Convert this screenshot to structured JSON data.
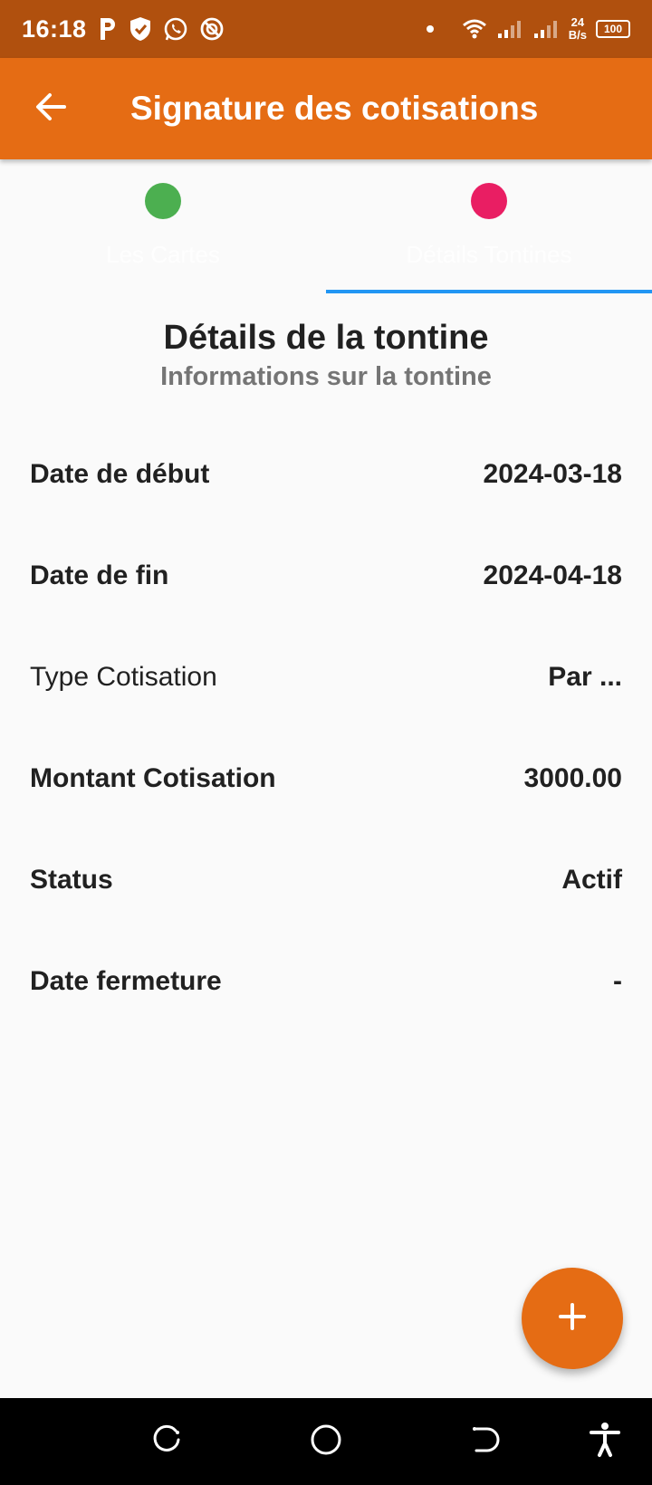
{
  "status_bar": {
    "time": "16:18",
    "net_speed_value": "24",
    "net_speed_unit": "B/s",
    "battery": "100"
  },
  "app_bar": {
    "title": "Signature des cotisations"
  },
  "tabs": [
    {
      "label": "Les Cartes",
      "dot_color": "#4caf50",
      "selected": false
    },
    {
      "label": "Détails Tontines",
      "dot_color": "#e91e63",
      "selected": true
    }
  ],
  "section": {
    "title": "Détails de la tontine",
    "subtitle": "Informations sur la tontine"
  },
  "details": [
    {
      "label": "Date de début",
      "value": "2024-03-18"
    },
    {
      "label": "Date de fin",
      "value": "2024-04-18"
    },
    {
      "label": "Type Cotisation",
      "value": "Par ..."
    },
    {
      "label": "Montant Cotisation",
      "value": "3000.00"
    },
    {
      "label": "Status",
      "value": "Actif"
    },
    {
      "label": "Date fermeture",
      "value": "-"
    }
  ],
  "colors": {
    "status_bar": "#b0500e",
    "app_bar": "#e56c14",
    "tab_indicator": "#2196f3",
    "fab": "#e56c14"
  },
  "icons": {
    "back": "arrow-back-icon",
    "fab": "plus-icon",
    "nav_recent": "recent-apps-icon",
    "nav_home": "home-circle-icon",
    "nav_back": "nav-back-icon",
    "nav_accessibility": "accessibility-icon"
  }
}
